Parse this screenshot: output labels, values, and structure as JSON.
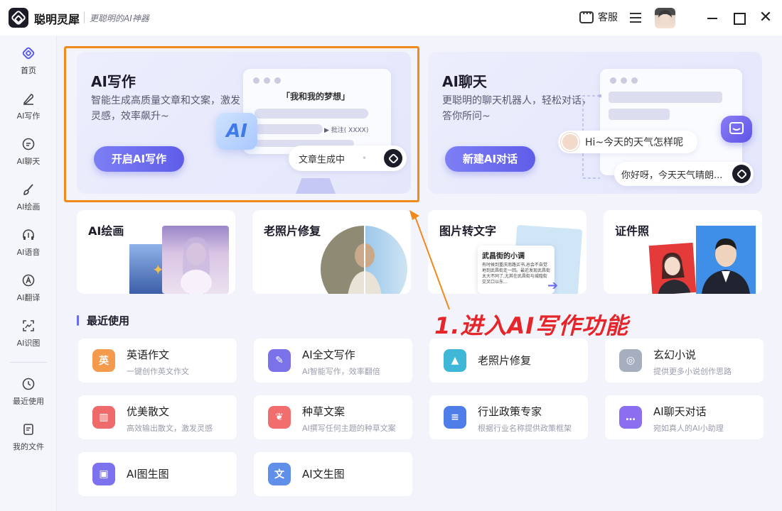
{
  "app": {
    "name": "聪明灵犀",
    "tagline": "更聪明的AI神器"
  },
  "titlebar": {
    "service_label": "客服"
  },
  "sidebar": {
    "items": [
      {
        "label": "首页",
        "icon": "home-icon"
      },
      {
        "label": "AI写作",
        "icon": "pen-icon"
      },
      {
        "label": "AI聊天",
        "icon": "chat-icon"
      },
      {
        "label": "AI绘画",
        "icon": "brush-icon"
      },
      {
        "label": "AI语音",
        "icon": "headphone-icon"
      },
      {
        "label": "AI翻译",
        "icon": "translate-icon"
      },
      {
        "label": "AI识图",
        "icon": "scan-icon"
      }
    ],
    "bottom_items": [
      {
        "label": "最近使用",
        "icon": "history-icon"
      },
      {
        "label": "我的文件",
        "icon": "file-icon"
      }
    ]
  },
  "hero_writing": {
    "title": "AI写作",
    "desc": "智能生成高质量文章和文案，激发灵感，效率飙升~",
    "button": "开启AI写作",
    "doc_title": "「我和我的梦想」",
    "annotation": "批注( XXXX)",
    "badge": "AI",
    "status": "文章生成中"
  },
  "hero_chat": {
    "title": "AI聊天",
    "desc": "更聪明的聊天机器人，轻松对话，答你所问~",
    "button": "新建AI对话",
    "question": "Hi~今天的天气怎样呢",
    "answer": "你好呀，今天天气晴朗..."
  },
  "features": [
    {
      "title": "AI绘画"
    },
    {
      "title": "老照片修复"
    },
    {
      "title": "图片转文字",
      "doc_heading": "武昌街的小调",
      "doc_body": "有时候到重庆南路买书,总会不自觉地到武昌街走一回。最近发现武昌街太大不同了,尤其在武昌街与城隍街交叉口以东..."
    },
    {
      "title": "证件照"
    }
  ],
  "recent": {
    "title": "最近使用",
    "tools": [
      {
        "name": "英语作文",
        "desc": "一键创作英文作文",
        "icon": "english-essay-icon",
        "glyph": "英",
        "color": "#f39a4c"
      },
      {
        "name": "AI全文写作",
        "desc": "AI智能写作，效率翻倍",
        "icon": "quill-icon",
        "glyph": "✎",
        "color": "#7b72ea"
      },
      {
        "name": "老照片修复",
        "desc": "",
        "icon": "photo-restore-icon",
        "glyph": "▲",
        "color": "#3fb8d8"
      },
      {
        "name": "玄幻小说",
        "desc": "提供更多小说创作思路",
        "icon": "novel-icon",
        "glyph": "◎",
        "color": "#a7aebf"
      },
      {
        "name": "优美散文",
        "desc": "高效输出散文，激发灵感",
        "icon": "prose-icon",
        "glyph": "▥",
        "color": "#ef6b6b"
      },
      {
        "name": "种草文案",
        "desc": "AI撰写任何主题的种草文案",
        "icon": "sprout-icon",
        "glyph": "❦",
        "color": "#f26d6d"
      },
      {
        "name": "行业政策专家",
        "desc": "根据行业名称提供政策框架",
        "icon": "policy-icon",
        "glyph": "≡",
        "color": "#4f7ee8"
      },
      {
        "name": "AI聊天对话",
        "desc": "宛如真人的AI小助理",
        "icon": "ai-chat-icon",
        "glyph": "…",
        "color": "#8b6ff0"
      },
      {
        "name": "AI图生图",
        "desc": "",
        "icon": "image-to-image-icon",
        "glyph": "▣",
        "color": "#7d72ee"
      },
      {
        "name": "AI文生图",
        "desc": "",
        "icon": "text-to-image-icon",
        "glyph": "文",
        "color": "#5f8fe9"
      }
    ]
  },
  "annotation_text": "1.进入AI写作功能",
  "colors": {
    "accent": "#6a6cf0",
    "highlight": "#f08a1c",
    "annotation": "#e6252a"
  }
}
